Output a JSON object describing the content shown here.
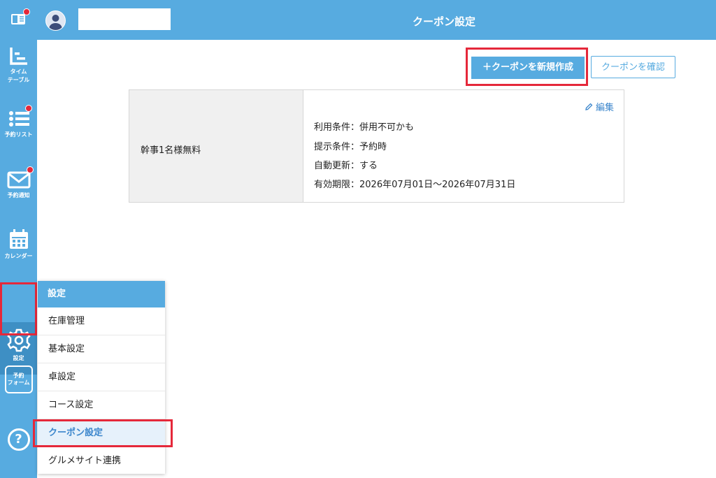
{
  "header": {
    "title": "クーポン設定"
  },
  "sidebar": {
    "items": [
      {
        "label_line1": "タイム",
        "label_line2": "テーブル"
      },
      {
        "label": "予約リスト"
      },
      {
        "label": "予約通知"
      },
      {
        "label": "カレンダー"
      },
      {
        "label": "設定"
      },
      {
        "label_line1": "予約",
        "label_line2": "フォーム"
      },
      {
        "label": "?"
      }
    ]
  },
  "toolbar": {
    "create_label": "＋クーポンを新規作成",
    "confirm_label": "クーポンを確認"
  },
  "coupon": {
    "name": "幹事1名様無料",
    "edit_label": "編集",
    "conditions": [
      "利用条件：併用不可かも",
      "提示条件：予約時",
      "自動更新：する",
      "有効期限：2026年07月01日〜2026年07月31日"
    ]
  },
  "settings_menu": {
    "header": "設定",
    "items": [
      "在庫管理",
      "基本設定",
      "卓設定",
      "コース設定",
      "クーポン設定",
      "グルメサイト連携"
    ],
    "active": "クーポン設定"
  },
  "colors": {
    "primary": "#57abe0",
    "highlight": "#e5283a",
    "link": "#3b86cc"
  }
}
